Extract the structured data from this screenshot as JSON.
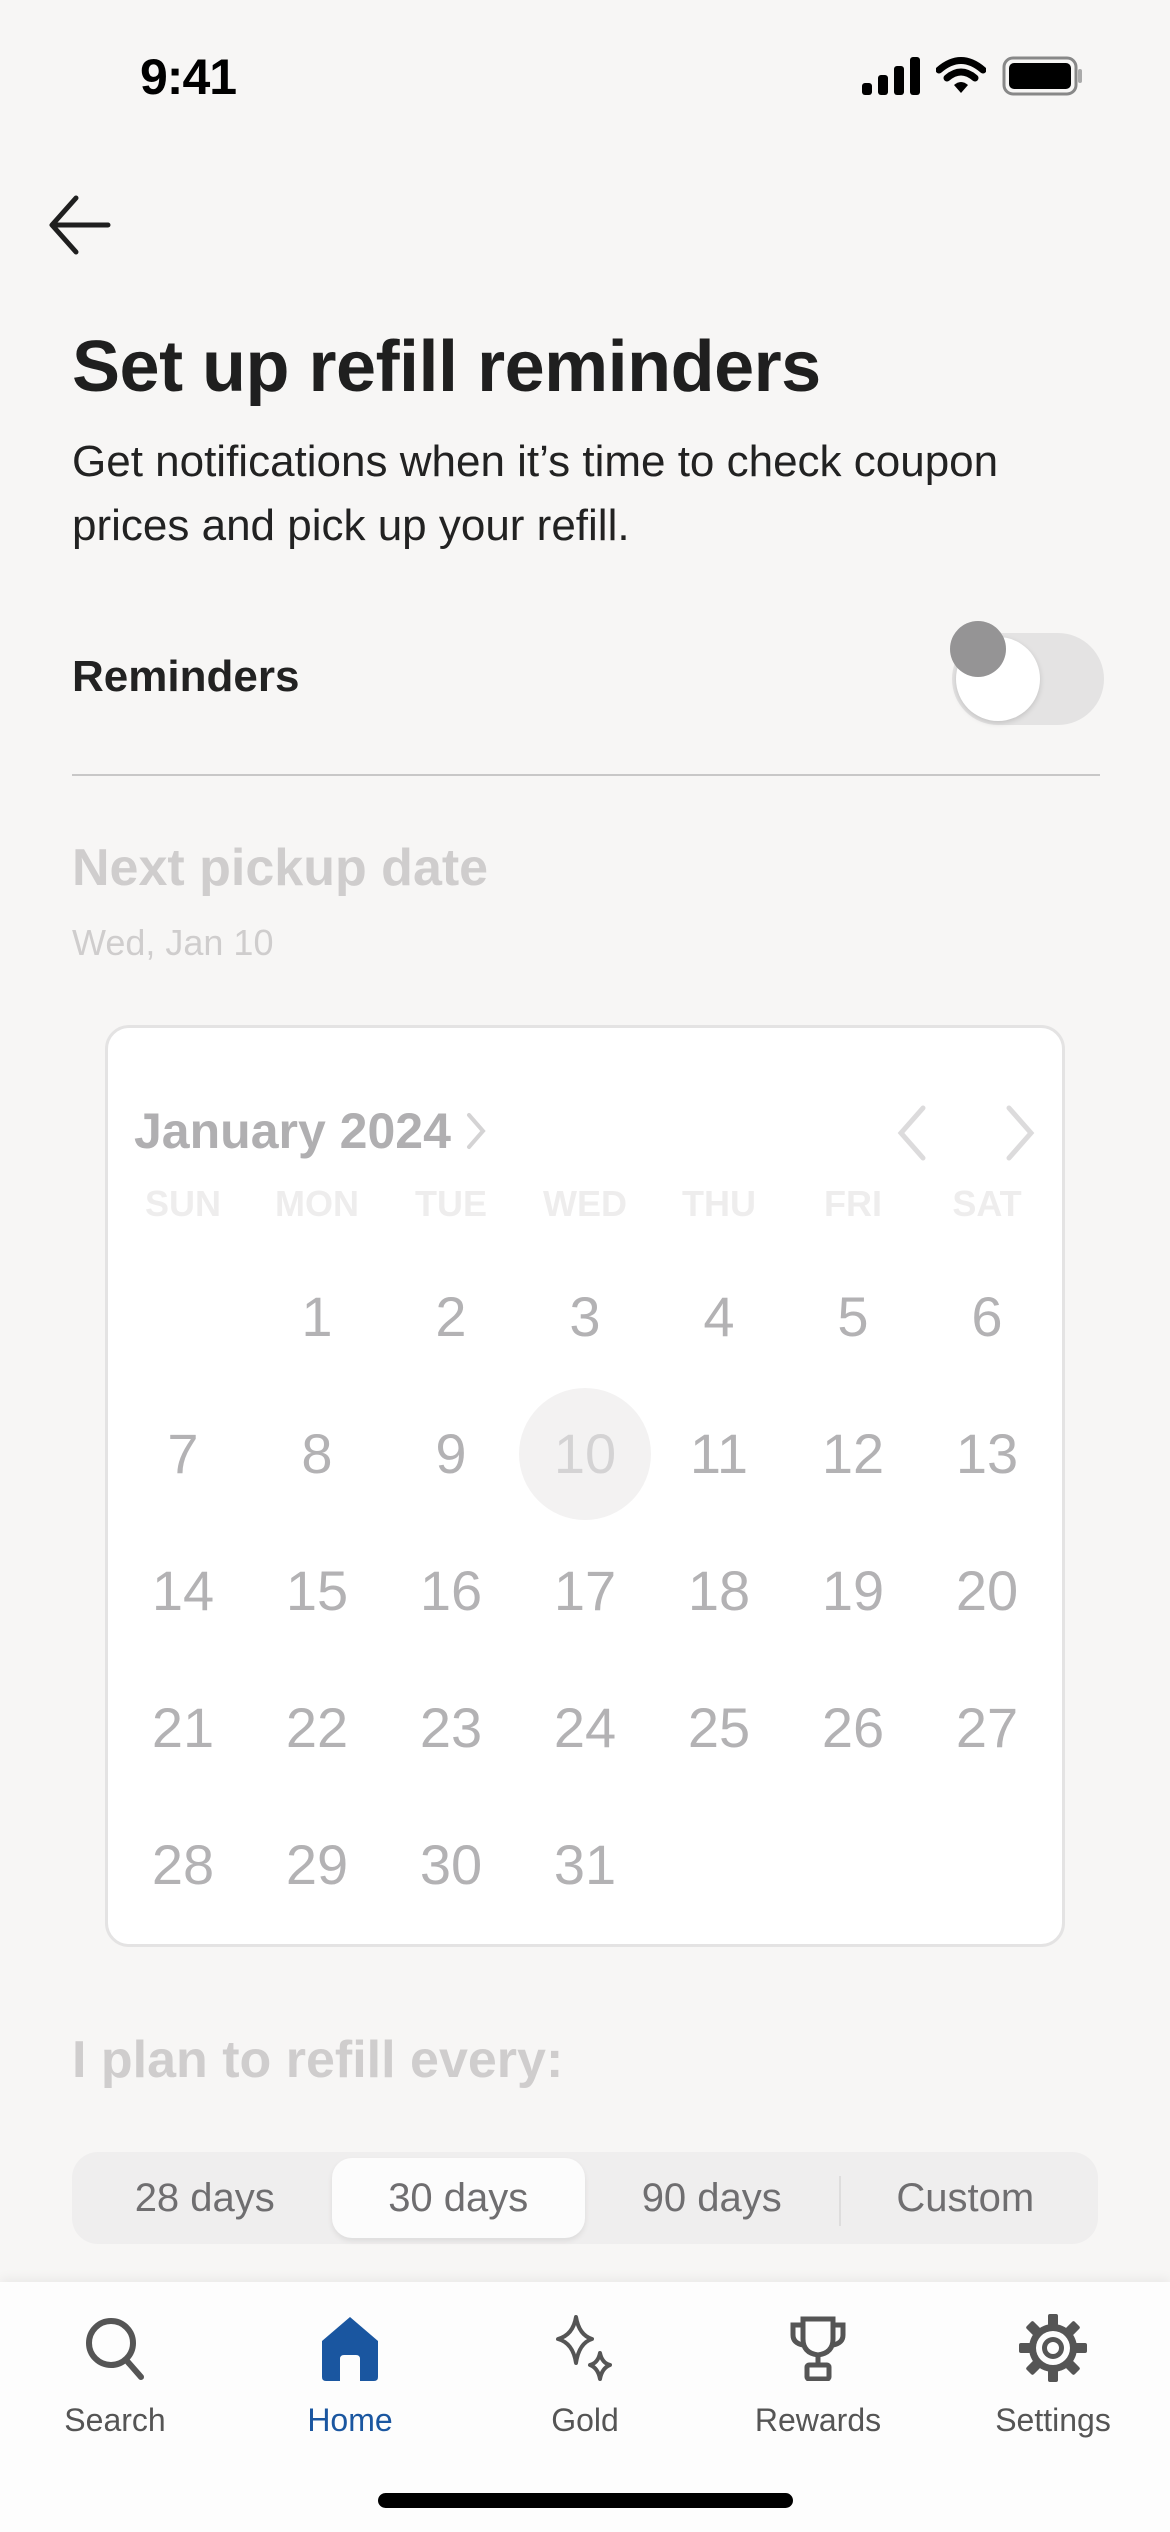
{
  "status_bar": {
    "time": "9:41"
  },
  "header": {
    "back_label": "Back",
    "title": "Set up refill reminders",
    "subtitle": "Get notifications when it’s time to check coupon prices and pick up your refill."
  },
  "reminders": {
    "label": "Reminders",
    "enabled": false
  },
  "pickup": {
    "title": "Next pickup date",
    "date": "Wed, Jan 10"
  },
  "calendar": {
    "month_label": "January 2024",
    "weekdays": [
      "SUN",
      "MON",
      "TUE",
      "WED",
      "THU",
      "FRI",
      "SAT"
    ],
    "first_weekday_offset": 1,
    "days_in_month": 31,
    "selected_day": 10
  },
  "refill": {
    "title": "I plan to refill every:",
    "options": [
      "28 days",
      "30 days",
      "90 days",
      "Custom"
    ],
    "selected_index": 1
  },
  "tab_bar": {
    "items": [
      {
        "label": "Search",
        "icon": "search-icon"
      },
      {
        "label": "Home",
        "icon": "home-icon",
        "active": true
      },
      {
        "label": "Gold",
        "icon": "sparkle-icon"
      },
      {
        "label": "Rewards",
        "icon": "trophy-icon"
      },
      {
        "label": "Settings",
        "icon": "gear-icon"
      }
    ]
  },
  "colors": {
    "accent": "#1a56a0",
    "background": "#f7f6f5",
    "muted_text": "#b3b2b4"
  }
}
